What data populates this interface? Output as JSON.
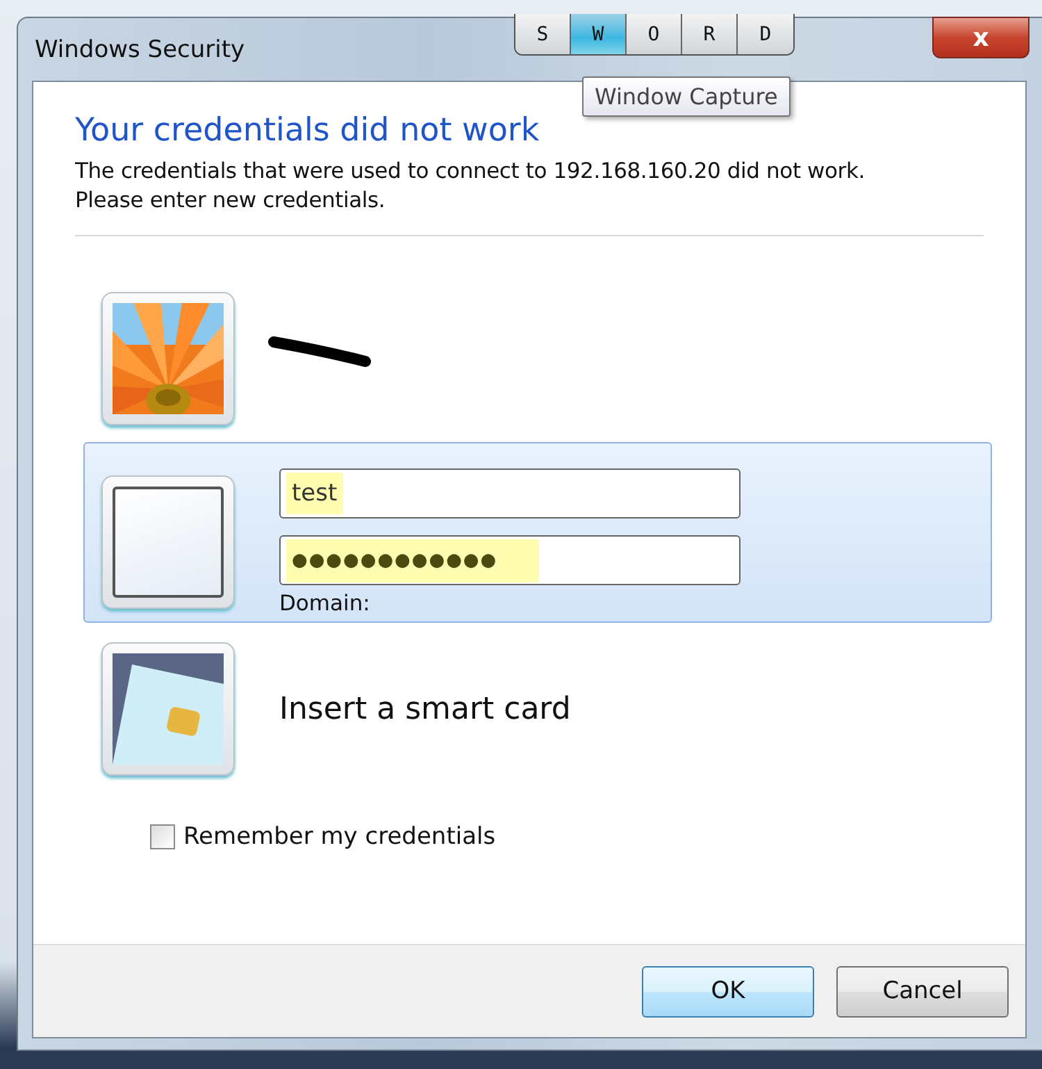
{
  "window": {
    "title": "Windows Security",
    "close_label": "x"
  },
  "toolbar": {
    "buttons": [
      {
        "label": "S",
        "selected": false
      },
      {
        "label": "W",
        "selected": true
      },
      {
        "label": "O",
        "selected": false
      },
      {
        "label": "R",
        "selected": false
      },
      {
        "label": "D",
        "selected": false
      }
    ]
  },
  "tooltip": "Window Capture",
  "heading": "Your credentials did not work",
  "message": [
    "The credentials that were used to connect to 192.168.160.20 did not work.",
    "Please enter new credentials."
  ],
  "tiles": [
    {
      "kind": "user",
      "selected": false
    },
    {
      "kind": "credentials",
      "selected": true,
      "fields": [
        {
          "value": "test",
          "autofilled": true
        },
        {
          "value": "●●●●●●●●●●●●",
          "autofilled": true
        }
      ],
      "domain_label": "Domain:"
    },
    {
      "kind": "smartcard",
      "selected": false,
      "label": "Insert a smart card"
    }
  ],
  "remember": {
    "label": "Remember my credentials",
    "checked": false
  },
  "buttons": [
    {
      "label": "OK",
      "default": true
    },
    {
      "label": "Cancel",
      "default": false
    }
  ]
}
